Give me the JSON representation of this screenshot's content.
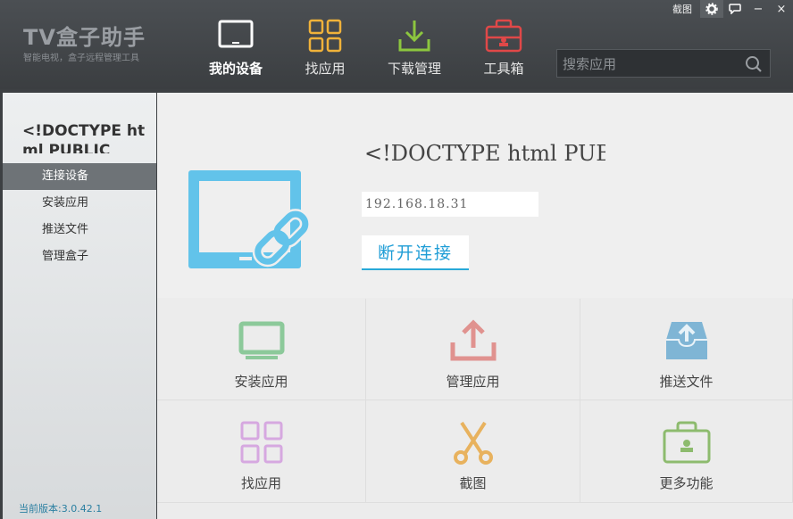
{
  "app": {
    "title": "TV盒子助手",
    "subtitle": "智能电视，盒子远程管理工具"
  },
  "window_controls": {
    "screenshot_label": "截图",
    "settings_icon": "gear-icon",
    "feedback_icon": "chat-icon",
    "minimize_label": "−",
    "close_label": "×"
  },
  "top_nav": [
    {
      "label": "我的设备",
      "icon": "tv-icon",
      "active": true
    },
    {
      "label": "找应用",
      "icon": "grid-icon",
      "active": false
    },
    {
      "label": "下载管理",
      "icon": "download-icon",
      "active": false
    },
    {
      "label": "工具箱",
      "icon": "toolbox-icon",
      "active": false
    }
  ],
  "search": {
    "placeholder": "搜索应用",
    "value": ""
  },
  "sidebar": {
    "title": "<!DOCTYPE html PUBLIC",
    "items": [
      {
        "label": "连接设备",
        "active": true
      },
      {
        "label": "安装应用",
        "active": false
      },
      {
        "label": "推送文件",
        "active": false
      },
      {
        "label": "管理盒子",
        "active": false
      }
    ],
    "version": "当前版本:3.0.42.1"
  },
  "device": {
    "name": "<!DOCTYPE html PUBLIC",
    "ip": "192.168.18.31",
    "disconnect_label": "断开连接",
    "status_icon": "checkmark-icon",
    "status_color": "#4caf50"
  },
  "tools": [
    {
      "label": "安装应用",
      "icon": "monitor-icon",
      "color": "#8cc99a"
    },
    {
      "label": "管理应用",
      "icon": "upload-icon",
      "color": "#e0928f"
    },
    {
      "label": "推送文件",
      "icon": "inbox-upload-icon",
      "color": "#7fb5d5"
    },
    {
      "label": "找应用",
      "icon": "grid-icon",
      "color": "#d6a8e0"
    },
    {
      "label": "截图",
      "icon": "scissors-icon",
      "color": "#e8b25e"
    },
    {
      "label": "更多功能",
      "icon": "toolbox-icon",
      "color": "#8dbb6e"
    }
  ]
}
